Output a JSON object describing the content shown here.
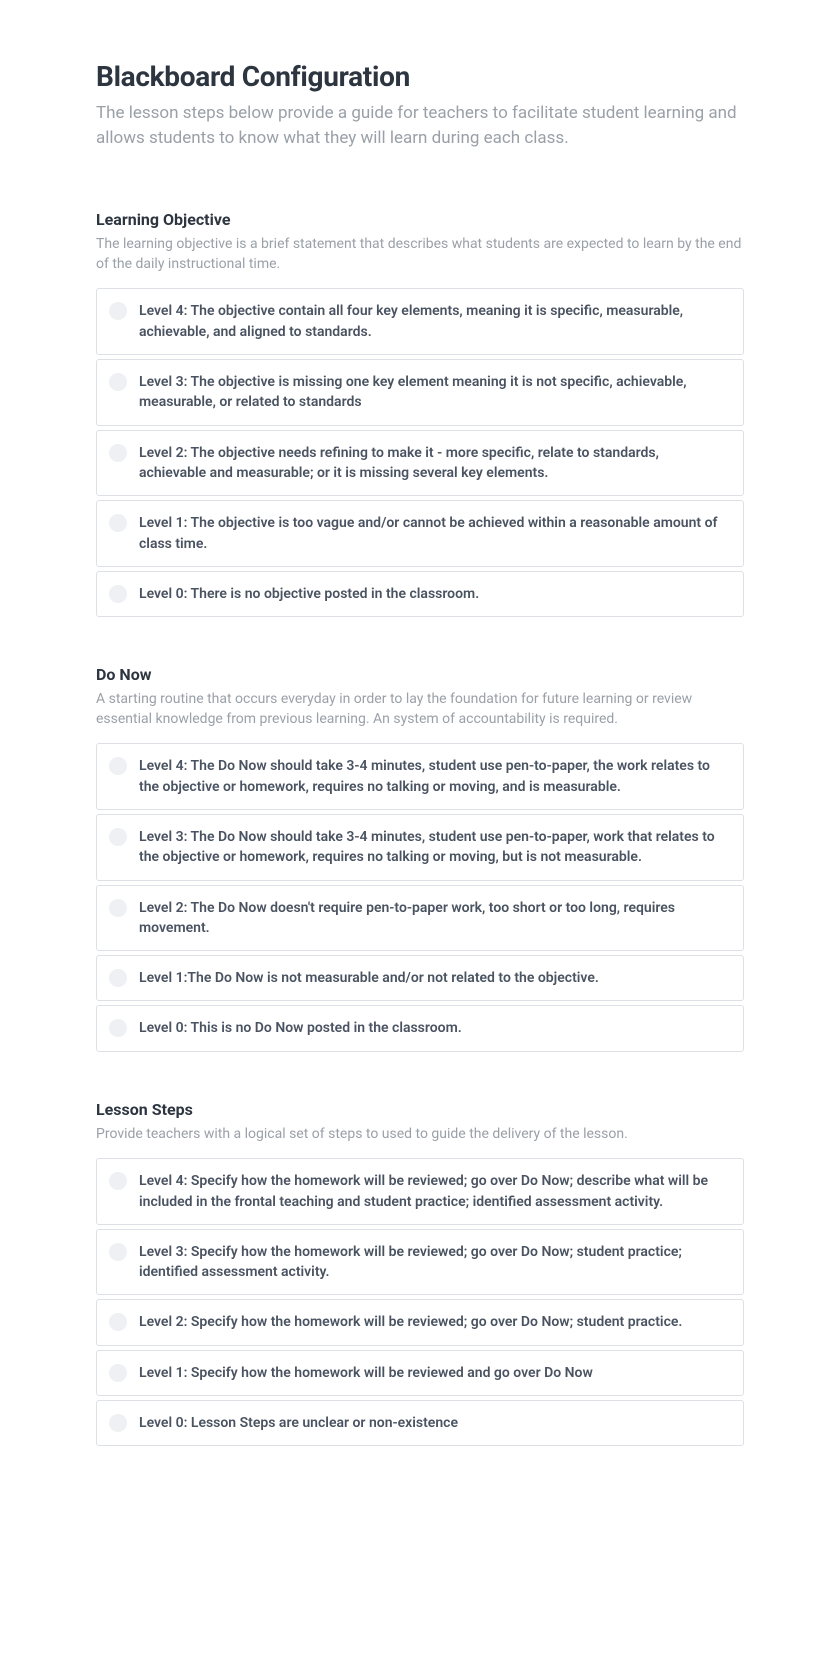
{
  "title": "Blackboard Configuration",
  "description": "The lesson steps below provide a guide for teachers to facilitate student learning and allows students to know what they will learn during each class.",
  "sections": [
    {
      "title": "Learning Objective",
      "description": "The learning objective is a brief statement that describes what students are expected to learn by the end of the daily instructional time.",
      "options": [
        "Level 4: The objective contain all four key elements, meaning it is specific, measurable, achievable, and aligned to standards.",
        "Level 3: The objective is missing one key element meaning it is not specific, achievable, measurable, or related to standards",
        "Level 2: The objective needs refining to make it - more specific, relate to standards, achievable and measurable; or it is missing several key elements.",
        "Level 1: The objective is too vague and/or cannot be achieved within a reasonable amount of class time.",
        "Level 0: There is no objective posted in the classroom."
      ]
    },
    {
      "title": "Do Now",
      "description": "A starting routine that occurs everyday in order to lay the foundation for future learning or review essential knowledge from previous learning. An system of accountability is required.",
      "options": [
        "Level 4: The Do Now should take 3-4 minutes, student use pen-to-paper, the work relates to the objective or homework, requires no talking or moving, and is measurable.",
        "Level 3: The Do Now should take 3-4 minutes, student use pen-to-paper, work that relates to the objective or homework, requires no talking or moving, but is not measurable.",
        "Level 2: The Do Now doesn't require pen-to-paper work, too short or too long, requires movement.",
        "Level 1:The Do Now is not measurable and/or not related to the objective.",
        "Level 0: This is no Do Now posted in the classroom."
      ]
    },
    {
      "title": "Lesson Steps",
      "description": "Provide teachers with a logical set of steps to used to guide the delivery of the lesson.",
      "options": [
        "Level 4: Specify how the homework will be reviewed; go over Do Now; describe what will be included in the frontal teaching and student practice; identified assessment activity.",
        "Level 3: Specify how the homework will be reviewed; go over Do Now; student practice; identified assessment activity.",
        "Level 2: Specify how the homework will be reviewed; go over Do Now; student practice.",
        "Level 1: Specify how the homework will be reviewed and go over Do Now",
        "Level 0: Lesson Steps are unclear or non-existence"
      ]
    }
  ]
}
